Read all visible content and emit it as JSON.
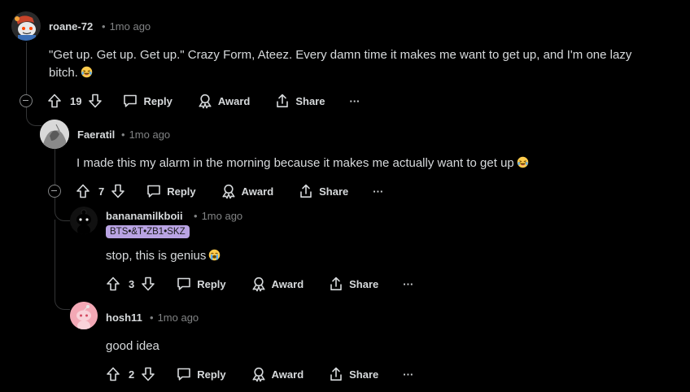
{
  "comments": [
    {
      "username": "roane-72",
      "time": "1mo ago",
      "text": "\"Get up. Get up. Get up.\" Crazy Form, Ateez. Every damn time it makes me want to get up, and I'm one lazy bitch.",
      "text_line1": "\"Get up. Get up. Get up.\" Crazy Form, Ateez. Every damn time it makes me want to get up, and I'm one lazy",
      "text_line2": "bitch.",
      "emoji": "laughing-emoji",
      "votes": "19"
    },
    {
      "username": "Faeratil",
      "time": "1mo ago",
      "text": "I made this my alarm in the morning because it makes me actually want to get up",
      "emoji": "laughing-emoji",
      "votes": "7"
    },
    {
      "username": "bananamilkboii",
      "time": "1mo ago",
      "flair": "BTS•&T•ZB1•SKZ",
      "text": "stop, this is genius",
      "emoji": "loudly-crying-emoji",
      "votes": "3"
    },
    {
      "username": "hosh11",
      "time": "1mo ago",
      "text": "good idea",
      "votes": "2"
    }
  ],
  "actions": {
    "reply": "Reply",
    "award": "Award",
    "share": "Share",
    "more": "···"
  },
  "separator": "•",
  "colors": {
    "background": "#000000",
    "text": "#d7dadc",
    "meta": "#818384",
    "thread_line": "#343536",
    "flair_bg": "#b9a3e3"
  }
}
